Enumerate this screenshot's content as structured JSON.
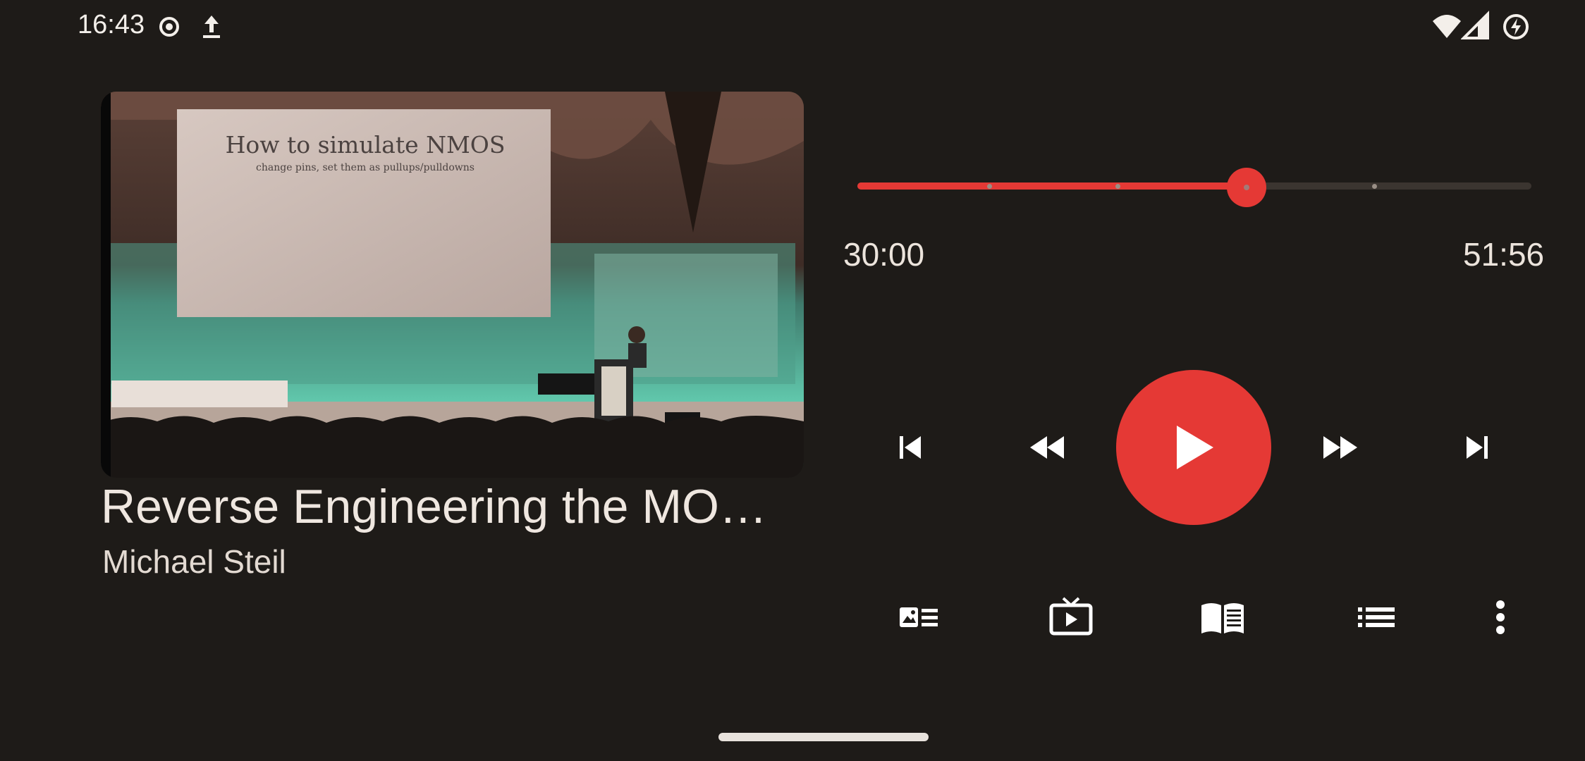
{
  "status_bar": {
    "time": "16:43",
    "left_icons": [
      "record-icon",
      "upload-icon"
    ],
    "right_icons": [
      "wifi-icon",
      "signal-icon",
      "battery-charging-icon"
    ]
  },
  "now_playing": {
    "artwork_icon": "video-thumbnail",
    "slide_title": "How to simulate NMOS",
    "slide_bullet": "change pins, set them as pullups/pulldowns",
    "title": "Reverse Engineering the MO…",
    "artist": "Michael Steil"
  },
  "seek": {
    "elapsed": "30:00",
    "duration": "51:56",
    "progress": 0.577,
    "chapter_markers": [
      0.196,
      0.387,
      0.577,
      0.767
    ]
  },
  "controls": {
    "previous": "skip-previous-icon",
    "rewind": "rewind-icon",
    "play": "play-icon",
    "fast_forward": "fast-forward-icon",
    "next": "skip-next-icon"
  },
  "actions": [
    "description-icon",
    "cast-tv-icon",
    "chapters-book-icon",
    "queue-list-icon",
    "more-vert-icon"
  ],
  "colors": {
    "accent": "#e53935",
    "background": "#1e1b18",
    "text": "#ece4dc"
  }
}
